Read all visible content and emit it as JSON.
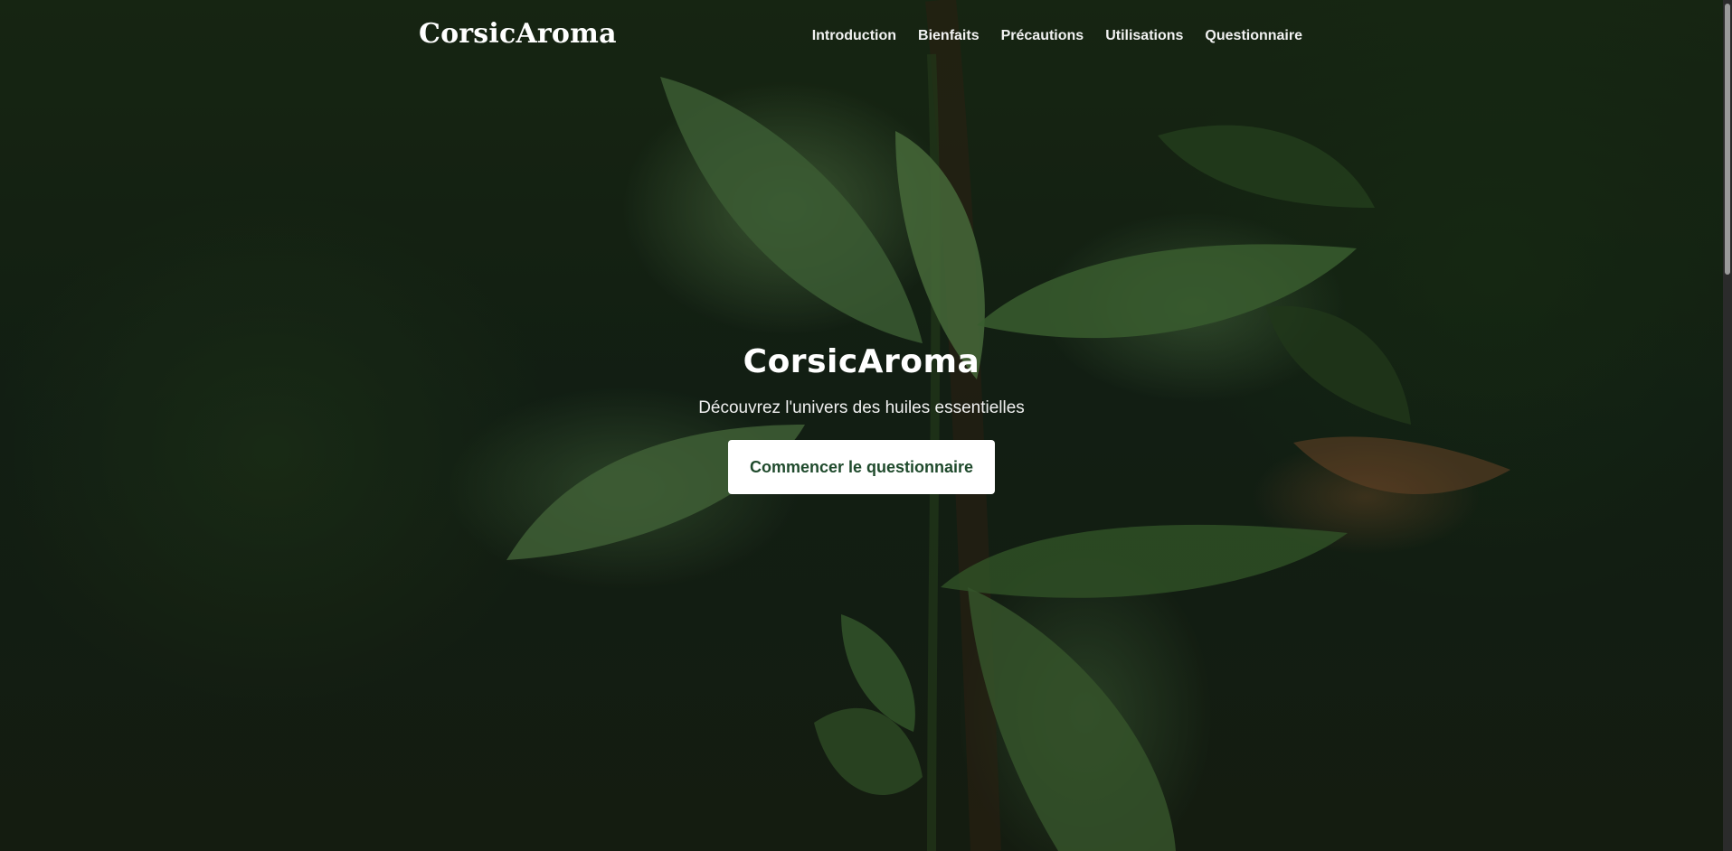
{
  "brand": {
    "name": "CorsicAroma"
  },
  "nav": {
    "links": [
      {
        "label": "Introduction"
      },
      {
        "label": "Bienfaits"
      },
      {
        "label": "Précautions"
      },
      {
        "label": "Utilisations"
      },
      {
        "label": "Questionnaire"
      }
    ]
  },
  "hero": {
    "title": "CorsicAroma",
    "subtitle": "Découvrez l'univers des huiles essentielles",
    "cta_label": "Commencer le questionnaire",
    "background": "mint-leaves-photo"
  },
  "colors": {
    "cta_text": "#1f4a2c",
    "cta_background": "#ffffff",
    "text_light": "#ffffff"
  }
}
